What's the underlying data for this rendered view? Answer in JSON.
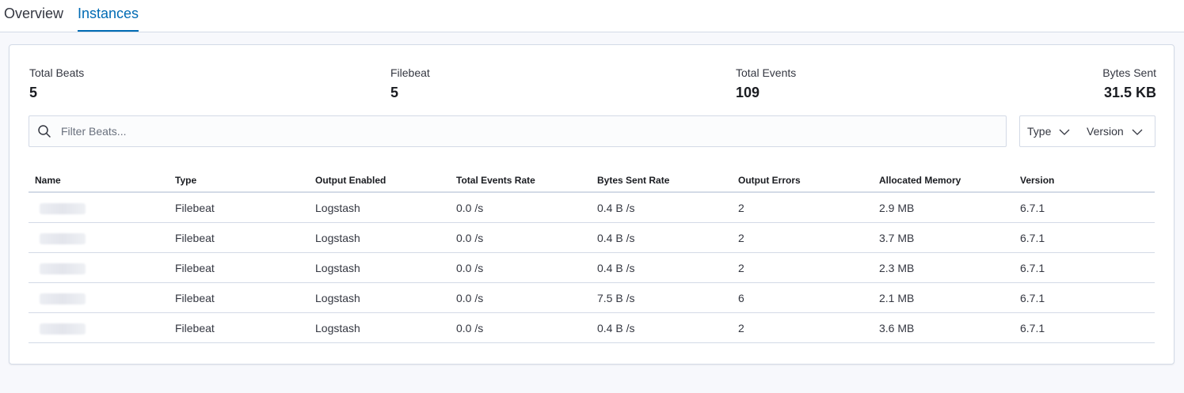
{
  "tabs": [
    {
      "label": "Overview"
    },
    {
      "label": "Instances"
    }
  ],
  "stats": [
    {
      "label": "Total Beats",
      "value": "5"
    },
    {
      "label": "Filebeat",
      "value": "5"
    },
    {
      "label": "Total Events",
      "value": "109"
    },
    {
      "label": "Bytes Sent",
      "value": "31.5 KB"
    }
  ],
  "search": {
    "placeholder": "Filter Beats...",
    "icon": "search-icon"
  },
  "filters": {
    "type_label": "Type",
    "version_label": "Version"
  },
  "table": {
    "columns": [
      "Name",
      "Type",
      "Output Enabled",
      "Total Events Rate",
      "Bytes Sent Rate",
      "Output Errors",
      "Allocated Memory",
      "Version"
    ],
    "rows": [
      {
        "type": "Filebeat",
        "output": "Logstash",
        "events_rate": "0.0 /s",
        "bytes_rate": "0.4 B /s",
        "errors": "2",
        "memory": "2.9 MB",
        "version": "6.7.1"
      },
      {
        "type": "Filebeat",
        "output": "Logstash",
        "events_rate": "0.0 /s",
        "bytes_rate": "0.4 B /s",
        "errors": "2",
        "memory": "3.7 MB",
        "version": "6.7.1"
      },
      {
        "type": "Filebeat",
        "output": "Logstash",
        "events_rate": "0.0 /s",
        "bytes_rate": "0.4 B /s",
        "errors": "2",
        "memory": "2.3 MB",
        "version": "6.7.1"
      },
      {
        "type": "Filebeat",
        "output": "Logstash",
        "events_rate": "0.0 /s",
        "bytes_rate": "7.5 B /s",
        "errors": "6",
        "memory": "2.1 MB",
        "version": "6.7.1"
      },
      {
        "type": "Filebeat",
        "output": "Logstash",
        "events_rate": "0.0 /s",
        "bytes_rate": "0.4 B /s",
        "errors": "2",
        "memory": "3.6 MB",
        "version": "6.7.1"
      }
    ]
  },
  "colors": {
    "accent": "#006bb4",
    "border": "#d3dae6",
    "background": "#f7f8fc"
  }
}
